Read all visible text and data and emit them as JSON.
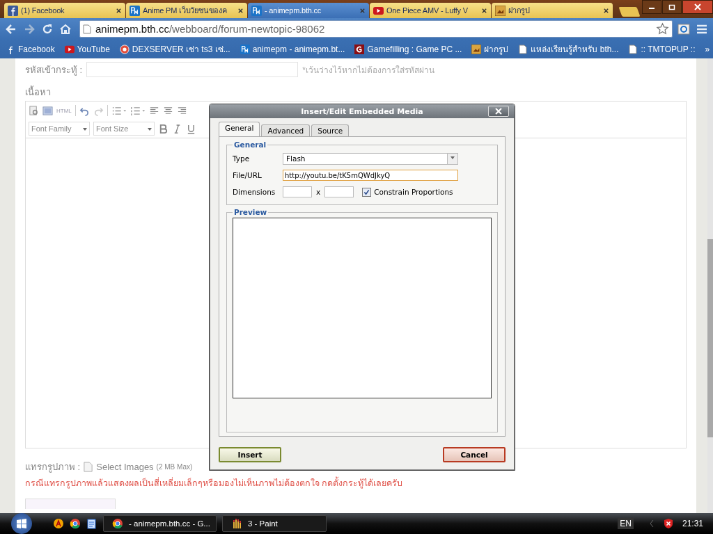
{
  "browser": {
    "tabs": [
      {
        "kind": "facebook",
        "label": "(1) Facebook",
        "selected": false
      },
      {
        "kind": "pm",
        "label": "Anime PM เว็บวัยซนของค",
        "selected": false
      },
      {
        "kind": "pm",
        "label": "- animepm.bth.cc",
        "selected": true
      },
      {
        "kind": "youtube",
        "label": "One Piece AMV - Luffy V",
        "selected": false
      },
      {
        "kind": "photo",
        "label": "ฝากรูป",
        "selected": false
      }
    ],
    "address": {
      "host": "animepm.bth.cc",
      "path": "/webboard/forum-newtopic-98062"
    },
    "bookmarks": [
      {
        "kind": "facebook",
        "label": "Facebook"
      },
      {
        "kind": "youtube",
        "label": "YouTube"
      },
      {
        "kind": "dex",
        "label": "DEXSERVER เช่า ts3 เซ่..."
      },
      {
        "kind": "pm",
        "label": "animepm - animepm.bt..."
      },
      {
        "kind": "g",
        "label": "Gamefilling : Game PC ..."
      },
      {
        "kind": "photo",
        "label": "ฝากรูป"
      },
      {
        "kind": "page",
        "label": "แหล่งเรียนรู้สำหรับ bth..."
      },
      {
        "kind": "page",
        "label": ":: TMTOPUP ::"
      }
    ],
    "more_bookmarks": "»"
  },
  "page": {
    "password_label": "รหัสเข้ากระทู้ :",
    "password_hint": "*เว้นว่างไว้หากไม่ต้องการใส่รหัสผ่าน",
    "content_label": "เนื้อหา",
    "font_family": "Font Family",
    "font_size": "Font Size",
    "html_label": "HTML",
    "insert_image_label": "แทรกรูปภาพ :",
    "select_images": "Select Images",
    "size_limit": "(2 MB Max)",
    "notice": "กรณีแทรกรูปภาพแล้วแสดงผลเป็นสี่เหลี่ยมเล็กๆหรือมองไม่เห็นภาพไม่ต้องตกใจ กดตั้งกระทู้ได้เลยครับ"
  },
  "dialog": {
    "title": "Insert/Edit Embedded Media",
    "tabs": [
      {
        "label": "General",
        "selected": true
      },
      {
        "label": "Advanced",
        "selected": false
      },
      {
        "label": "Source",
        "selected": false
      }
    ],
    "general_legend": "General",
    "type_label": "Type",
    "type_value": "Flash",
    "url_label": "File/URL",
    "url_value": "http://youtu.be/tK5mQWdJkyQ",
    "dimensions_label": "Dimensions",
    "times": "x",
    "constrain_label": "Constrain Proportions",
    "constrain_checked": true,
    "preview_legend": "Preview",
    "insert": "Insert",
    "cancel": "Cancel"
  },
  "taskbar": {
    "tasks": [
      {
        "kind": "chrome",
        "label": "- animepm.bth.cc - G..."
      },
      {
        "kind": "paint",
        "label": "3 - Paint"
      }
    ],
    "language": "EN",
    "time": "21:31"
  }
}
